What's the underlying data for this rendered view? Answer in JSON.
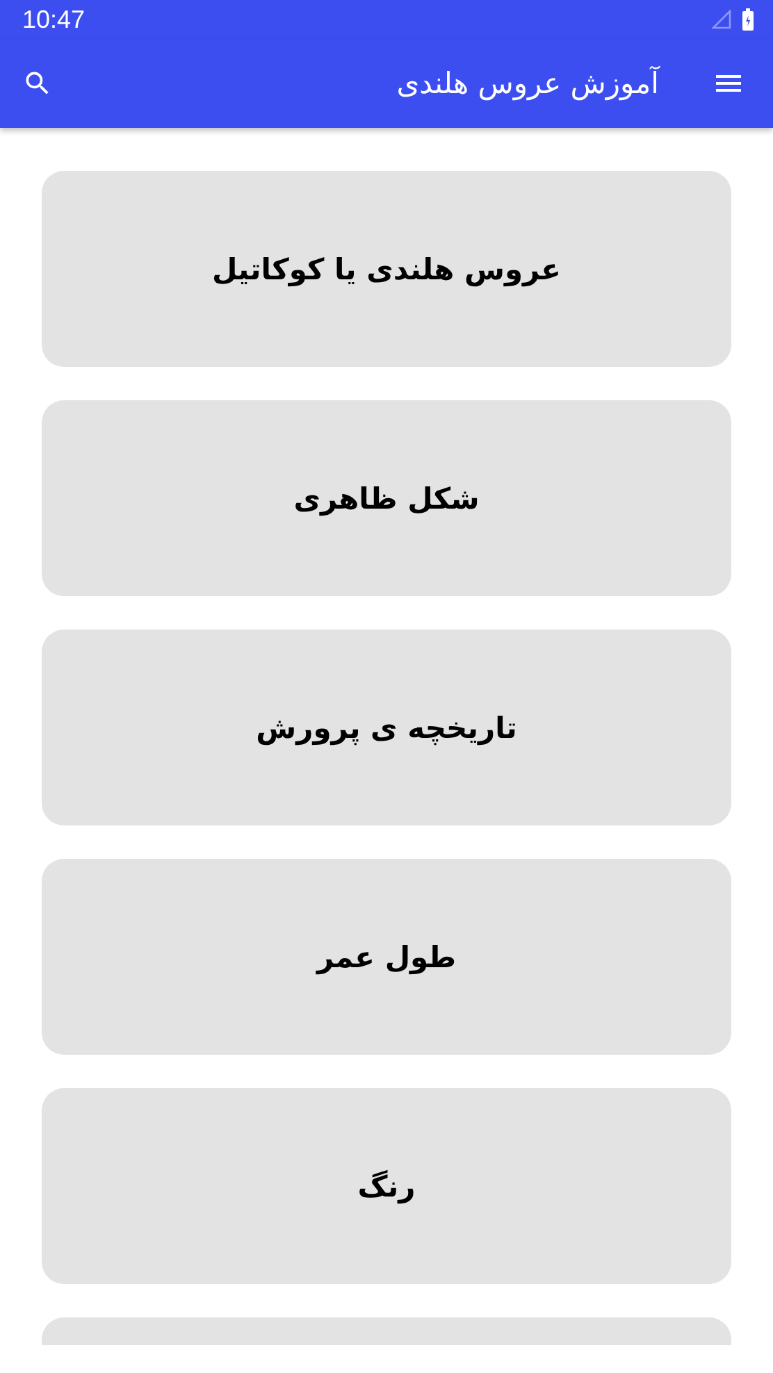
{
  "status_bar": {
    "time": "10:47"
  },
  "app_bar": {
    "title": "آموزش عروس هلندی"
  },
  "items": [
    {
      "title": "عروس هلندی یا کوکاتیل"
    },
    {
      "title": "شکل ظاهری"
    },
    {
      "title": "تاریخچه ی پرورش"
    },
    {
      "title": "طول عمر"
    },
    {
      "title": "رنگ"
    }
  ]
}
